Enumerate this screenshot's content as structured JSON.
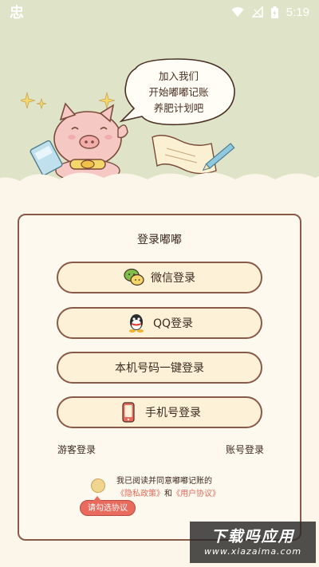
{
  "status_bar": {
    "time": "5:19",
    "left_icon": "忠"
  },
  "hero": {
    "bubble_lines": [
      "加入我们",
      "开始嘟嘟记账",
      "养肥计划吧"
    ]
  },
  "card": {
    "title": "登录嘟嘟",
    "wechat_label": "微信登录",
    "qq_label": "QQ登录",
    "onekey_label": "本机号码一键登录",
    "phone_label": "手机号登录",
    "guest_label": "游客登录",
    "account_label": "账号登录",
    "agree_line1": "我已阅读并同意嘟嘟记账的",
    "privacy_link": "《隐私政策》",
    "and_text": "和",
    "terms_link": "《用户协议》",
    "tip_text": "请勾选协议"
  },
  "watermark": {
    "title": "下载吗应用",
    "url": "www.xiazaima.com"
  },
  "colors": {
    "hero_bg": "#dfe4c9",
    "page_bg": "#fbf6e9",
    "border": "#8a5a48",
    "button_fill": "#fdf2d8",
    "accent": "#e86b5e"
  },
  "icons": [
    "wechat-icon",
    "qq-icon",
    "phone-icon",
    "wifi-icon",
    "signal-icon",
    "battery-icon"
  ]
}
